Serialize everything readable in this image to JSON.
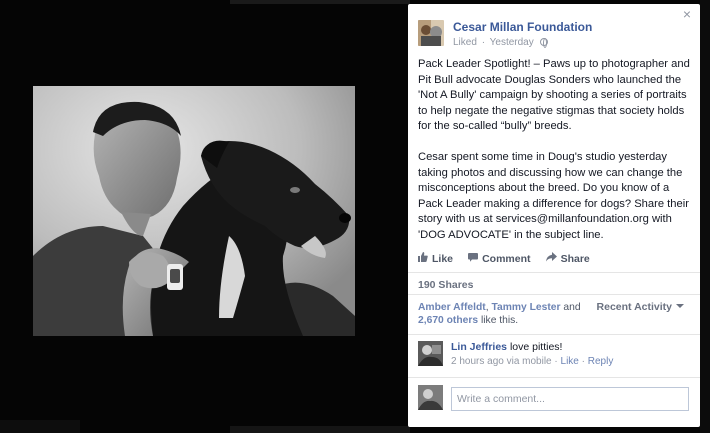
{
  "post": {
    "page_name": "Cesar Millan Foundation",
    "liked_label": "Liked",
    "separator": "·",
    "time": "Yesterday",
    "paragraphs": [
      "Pack Leader Spotlight! – Paws up to photographer and Pit Bull advocate Douglas Sonders who launched the 'Not A Bully' campaign by shooting a series of portraits to help negate the negative stigmas that society holds for the so-called “bully” breeds.",
      "Cesar spent some time in Doug's studio yesterday taking photos and discussing how we can change the misconceptions about the breed. Do you know of a Pack Leader making a difference for dogs? Share their story with us at services@millanfoundation.org with 'DOG ADVOCATE' in the subject line."
    ]
  },
  "actions": {
    "like": "Like",
    "comment": "Comment",
    "share": "Share"
  },
  "shares_label": "190 Shares",
  "likes": {
    "name1": "Amber Affeldt",
    "joiner": ", ",
    "name2": "Tammy Lester",
    "and": " and",
    "others": "2,670 others",
    "suffix": " like this."
  },
  "recent_activity": "Recent Activity",
  "comment": {
    "author": "Lin Jeffries",
    "text": "love pitties!",
    "time": "2 hours ago via mobile",
    "dot": " · ",
    "like": "Like",
    "reply": "Reply"
  },
  "composer": {
    "placeholder": "Write a comment..."
  },
  "close_symbol": "×",
  "icons": {
    "like": "thumbs-up-icon",
    "comment": "speech-bubble-icon",
    "share": "share-arrow-icon",
    "close": "close-icon",
    "privacy": "globe-icon"
  },
  "colors": {
    "link": "#3b5998",
    "text": "#141823",
    "muted": "#9197a3"
  }
}
